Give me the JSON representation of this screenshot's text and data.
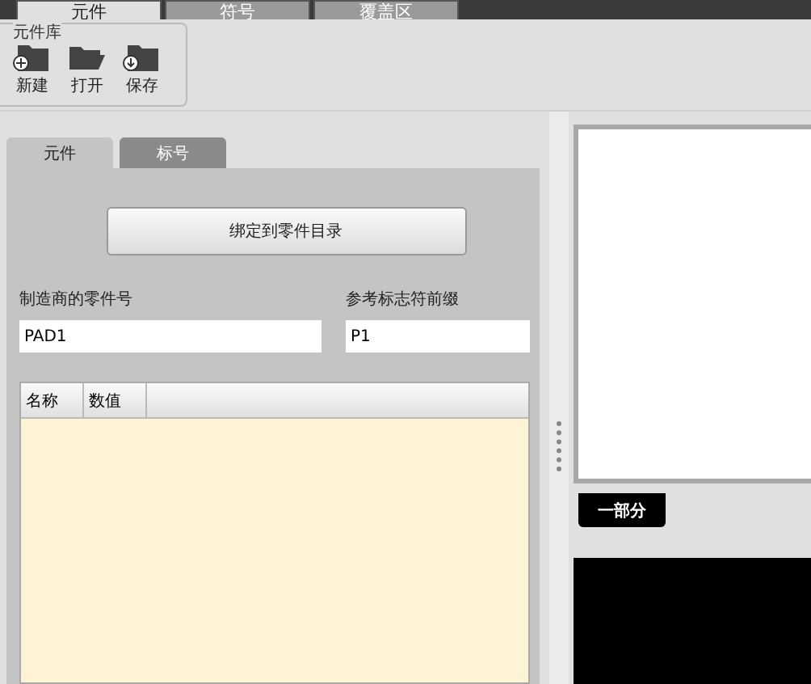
{
  "top_tabs": [
    {
      "label": "元件",
      "selected": true
    },
    {
      "label": "符号",
      "selected": false
    },
    {
      "label": "覆盖区",
      "selected": false
    }
  ],
  "ribbon": {
    "group_title": "元件库",
    "buttons": [
      {
        "kind": "new",
        "label": "新建"
      },
      {
        "kind": "open",
        "label": "打开"
      },
      {
        "kind": "save",
        "label": "保存"
      }
    ]
  },
  "inner_tabs": [
    {
      "label": "元件",
      "selected": true
    },
    {
      "label": "标号",
      "selected": false
    }
  ],
  "bind_button": "绑定到零件目录",
  "fields": [
    {
      "label": "制造商的零件号",
      "value": "PAD1"
    },
    {
      "label": "参考标志符前缀",
      "value": "P1"
    }
  ],
  "table": {
    "columns": [
      "名称",
      "数值"
    ]
  },
  "preview": {
    "tab": "一部分"
  }
}
